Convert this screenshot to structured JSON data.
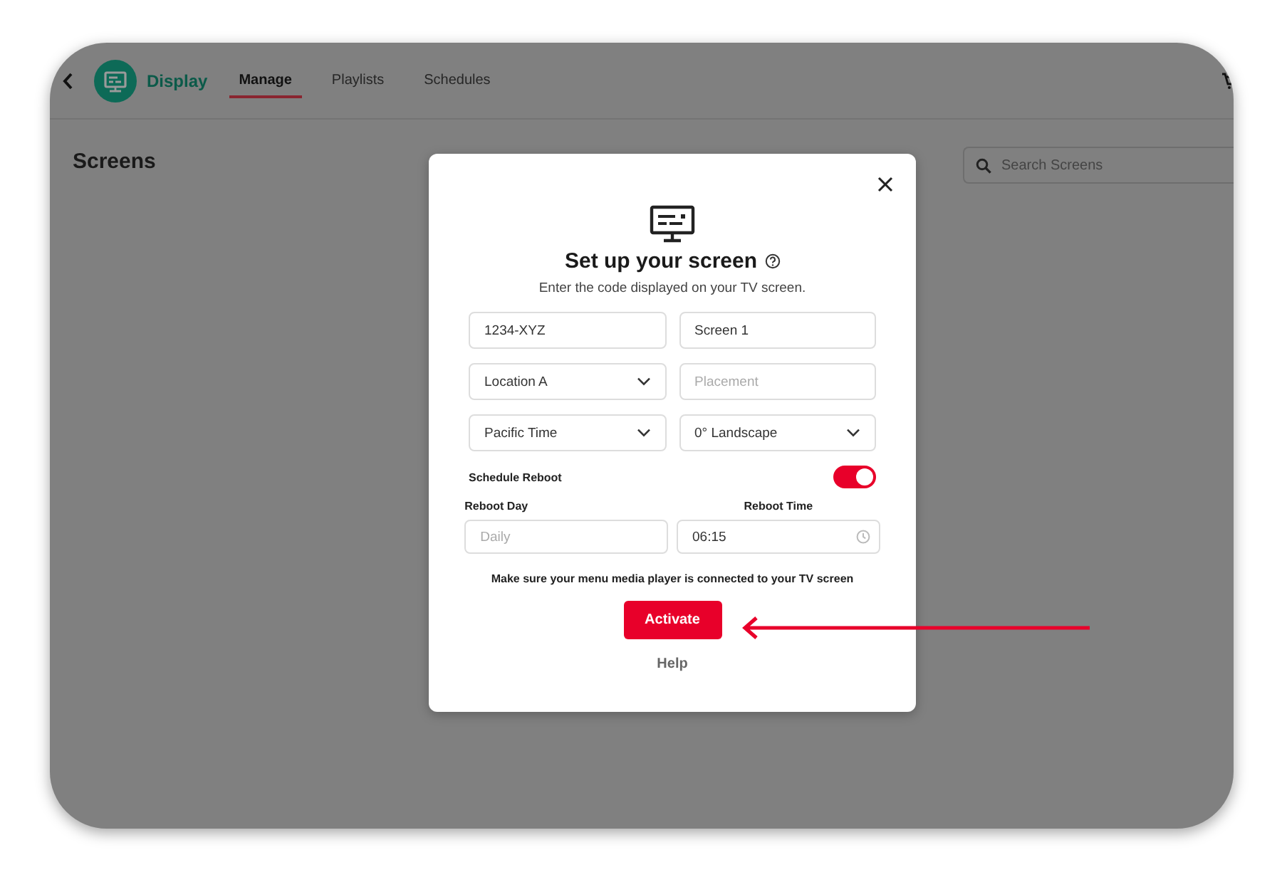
{
  "app": {
    "brand": "Display",
    "tabs": [
      {
        "label": "Manage",
        "selected": true
      },
      {
        "label": "Playlists",
        "selected": false
      },
      {
        "label": "Schedules",
        "selected": false
      }
    ],
    "page_title": "Screens",
    "search": {
      "placeholder": "Search Screens"
    }
  },
  "dialog": {
    "title": "Set up your screen",
    "subtitle": "Enter the code displayed on your TV screen.",
    "fields": [
      {
        "kind": "input",
        "value": "1234-XYZ"
      },
      {
        "kind": "input",
        "value": "Screen 1"
      },
      {
        "kind": "select",
        "value": "Location A"
      },
      {
        "kind": "input",
        "placeholder": "Placement"
      },
      {
        "kind": "select",
        "value": "Pacific Time"
      },
      {
        "kind": "select",
        "value": "0° Landscape"
      }
    ],
    "schedule_reboot": {
      "label": "Schedule Reboot",
      "on": true
    },
    "reboot_day": {
      "label": "Reboot Day",
      "placeholder": "Daily"
    },
    "reboot_time": {
      "label": "Reboot Time",
      "value": "06:15"
    },
    "note": "Make sure your menu media player is connected to your TV screen",
    "primary_button": "Activate",
    "help_link": "Help"
  }
}
